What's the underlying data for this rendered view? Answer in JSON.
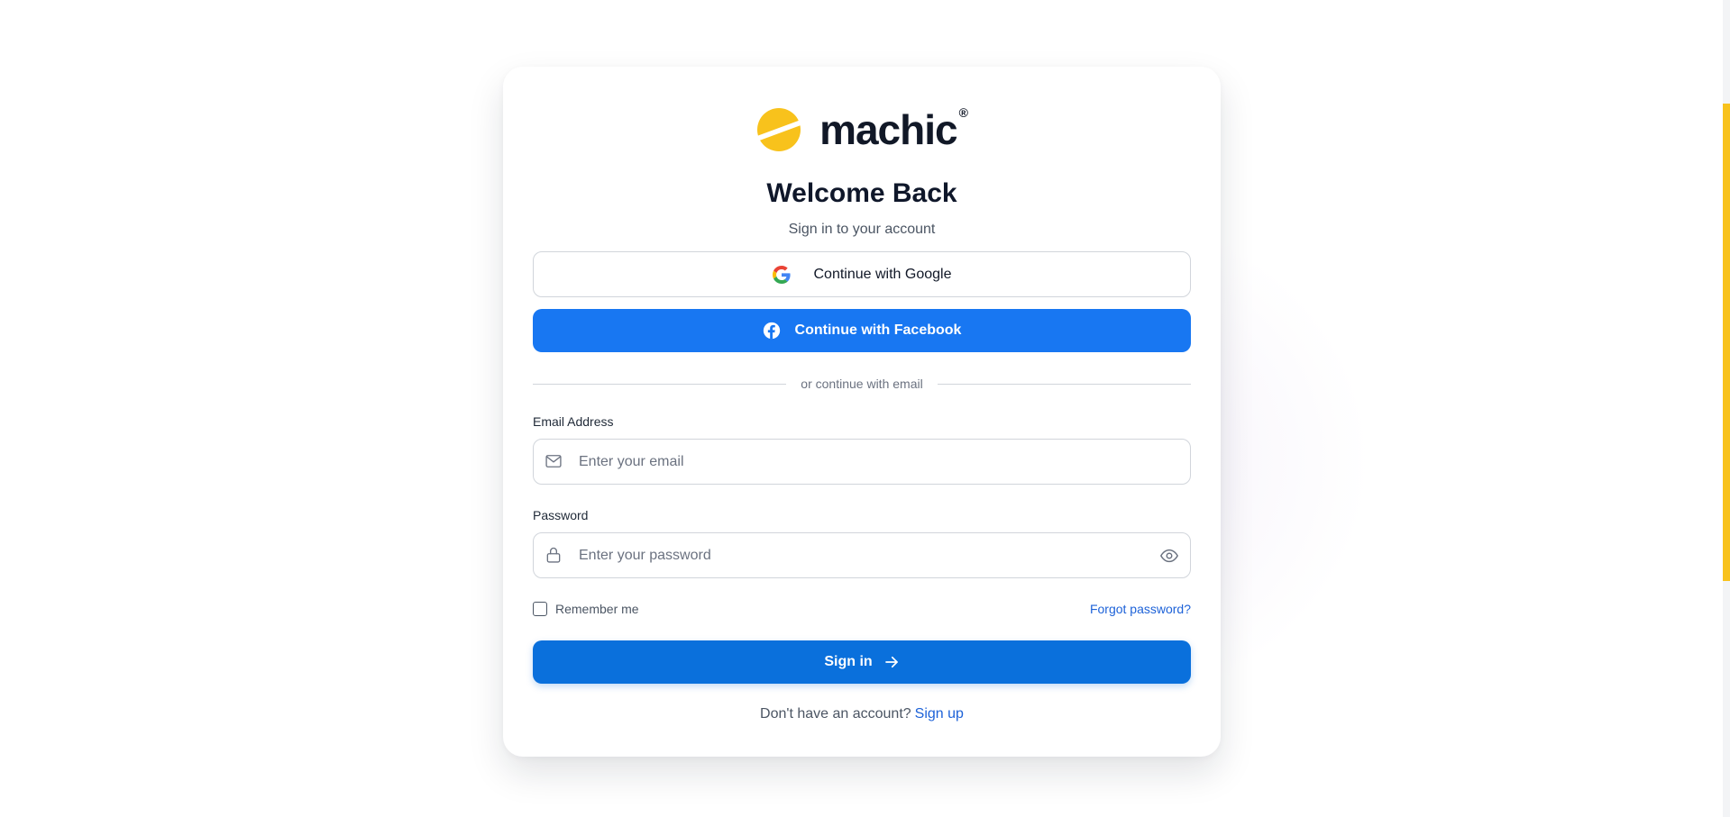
{
  "brand": {
    "name": "machic",
    "reg_mark": "®",
    "accent_color": "#f8c21c"
  },
  "header": {
    "title": "Welcome Back",
    "subtitle": "Sign in to your account"
  },
  "social": {
    "google_label": "Continue with Google",
    "facebook_label": "Continue with Facebook",
    "facebook_color": "#1877f2"
  },
  "divider": {
    "text": "or continue with email"
  },
  "form": {
    "email": {
      "label": "Email Address",
      "placeholder": "Enter your email",
      "value": ""
    },
    "password": {
      "label": "Password",
      "placeholder": "Enter your password",
      "value": ""
    },
    "remember_label": "Remember me",
    "remember_checked": false,
    "forgot_label": "Forgot password?",
    "submit_label": "Sign in",
    "submit_color": "#0a70dc"
  },
  "footer": {
    "prompt": "Don't have an account?",
    "signup_label": "Sign up"
  },
  "icons": [
    "logo-icon",
    "google-icon",
    "facebook-icon",
    "mail-icon",
    "lock-icon",
    "eye-icon",
    "arrow-right-icon"
  ]
}
